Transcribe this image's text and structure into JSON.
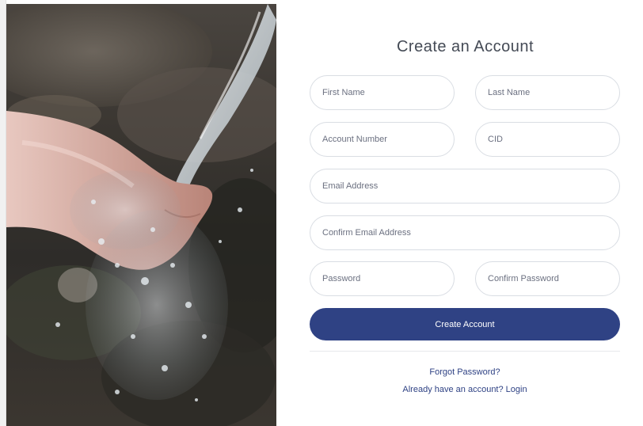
{
  "form": {
    "title": "Create an Account",
    "fields": {
      "first_name": {
        "placeholder": "First Name"
      },
      "last_name": {
        "placeholder": "Last Name"
      },
      "account_number": {
        "placeholder": "Account Number"
      },
      "cid": {
        "placeholder": "CID"
      },
      "email": {
        "placeholder": "Email Address"
      },
      "confirm_email": {
        "placeholder": "Confirm Email Address"
      },
      "password": {
        "placeholder": "Password"
      },
      "confirm_password": {
        "placeholder": "Confirm Password"
      }
    },
    "submit_label": "Create Account",
    "forgot_password_label": "Forgot Password?",
    "login_label": "Already have an account? Login"
  },
  "colors": {
    "primary": "#2f4284",
    "border": "#d9dde3",
    "title_text": "#444a55"
  },
  "image": {
    "subject": "hand-water-photo"
  }
}
